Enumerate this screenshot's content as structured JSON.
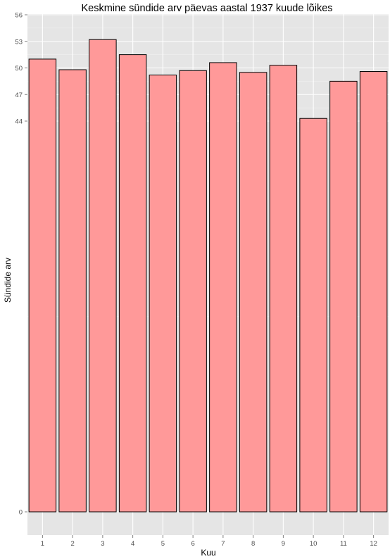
{
  "chart_data": {
    "type": "bar",
    "title": "Keskmine sündide arv päevas aastal 1937 kuude lõikes",
    "xlabel": "Kuu",
    "ylabel": "Sündide arv",
    "categories": [
      "1",
      "2",
      "3",
      "4",
      "5",
      "6",
      "7",
      "8",
      "9",
      "10",
      "11",
      "12"
    ],
    "values": [
      51.0,
      49.8,
      53.2,
      51.5,
      49.2,
      49.7,
      50.6,
      49.5,
      50.3,
      44.3,
      48.5,
      49.6
    ],
    "yticks": [
      0,
      44,
      47,
      50,
      53,
      56
    ],
    "ytick_labels": [
      "0",
      "44",
      "47",
      "50",
      "53",
      "56"
    ],
    "ylim": [
      0,
      56
    ],
    "y_axis_break": [
      0,
      44
    ],
    "grid": true,
    "legend": "none",
    "colors": {
      "panel": "#e5e5e5",
      "gridline": "#ffffff",
      "bar_fill": "#ff9999",
      "bar_stroke": "#000000",
      "tick_text": "#4d4d4d"
    }
  }
}
